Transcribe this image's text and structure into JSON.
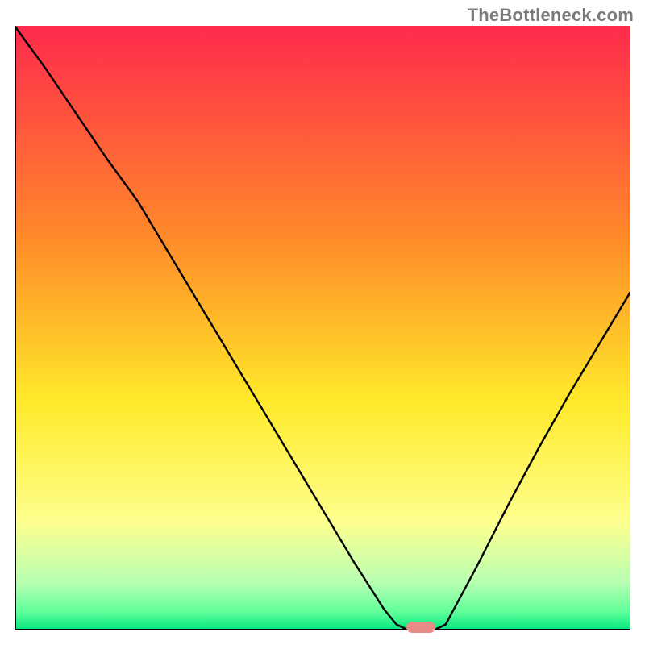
{
  "watermark": "TheBottleneck.com",
  "colors": {
    "gradient_top": "#ff2a4d",
    "gradient_mid1": "#ff8a2a",
    "gradient_mid2": "#ffe92a",
    "gradient_yellowpale": "#feff8e",
    "gradient_green_pale": "#b9ffb3",
    "gradient_green_mid": "#5fff9a",
    "gradient_green": "#00e57d",
    "axis": "#000000",
    "line": "#000000",
    "marker": "#e98b87"
  },
  "chart_data": {
    "type": "line",
    "title": "",
    "xlabel": "",
    "ylabel": "",
    "xlim": [
      0,
      100
    ],
    "ylim": [
      0,
      100
    ],
    "x": [
      0,
      5,
      10,
      15,
      20,
      25,
      30,
      35,
      40,
      45,
      50,
      55,
      60,
      62,
      64,
      68,
      70,
      75,
      80,
      85,
      90,
      95,
      100
    ],
    "values": [
      100,
      93,
      85.5,
      78,
      71,
      62.5,
      54,
      45.5,
      37,
      28.5,
      20,
      11.5,
      3.5,
      1,
      0,
      0,
      1,
      10.5,
      20.5,
      30,
      39,
      47.5,
      56
    ],
    "marker": {
      "x": 66,
      "y": 0.5
    },
    "grid": false,
    "legend": false
  }
}
